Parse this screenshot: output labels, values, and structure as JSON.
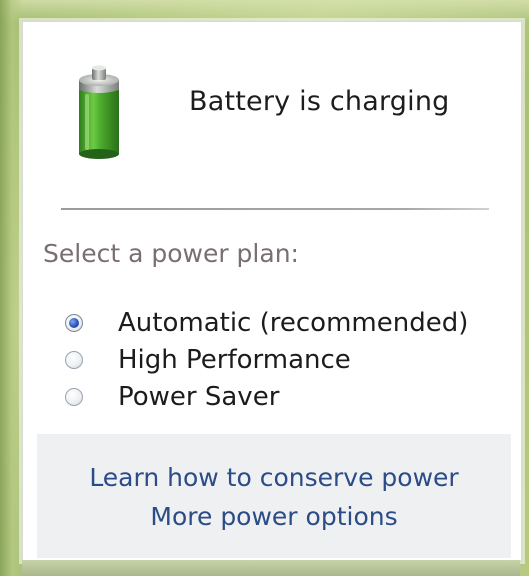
{
  "battery": {
    "status_text": "Battery is charging",
    "icon": "battery-charging-icon",
    "fill_level": 1.0,
    "colors": {
      "body_green": "#4caa2d",
      "body_dark": "#2d7d1d",
      "cap_gray": "#8f938f"
    }
  },
  "power_plan": {
    "heading": "Select a power plan:",
    "options": [
      {
        "label": "Automatic (recommended)",
        "selected": true
      },
      {
        "label": "High Performance",
        "selected": false
      },
      {
        "label": "Power Saver",
        "selected": false
      }
    ]
  },
  "footer": {
    "links": [
      {
        "label": "Learn how to conserve power"
      },
      {
        "label": "More power options"
      }
    ]
  },
  "theme": {
    "link_color": "#2b4c87",
    "heading_color": "#7a6e74",
    "radio_selected_color": "#2c54b8",
    "footer_bg": "#eff0f1"
  }
}
